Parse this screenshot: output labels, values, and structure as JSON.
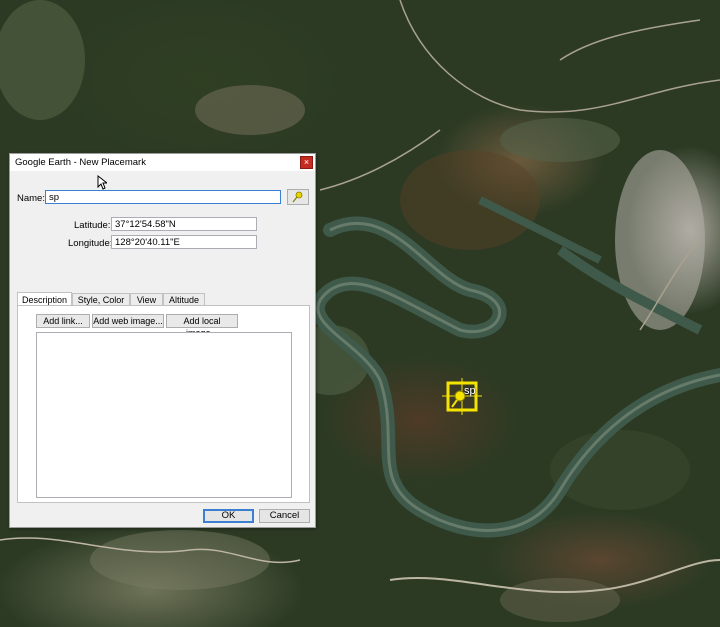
{
  "dialog": {
    "title": "Google Earth - New Placemark",
    "close_glyph": "×",
    "name_label": "Name:",
    "name_value": "sp",
    "latitude_label": "Latitude:",
    "latitude_value": "37°12'54.58\"N",
    "longitude_label": "Longitude:",
    "longitude_value": "128°20'40.11\"E",
    "icon_button": "pushpin-icon",
    "tabs": [
      "Description",
      "Style, Color",
      "View",
      "Altitude"
    ],
    "active_tab": "Description",
    "description_buttons": [
      "Add link...",
      "Add web image...",
      "Add local image..."
    ],
    "ok_label": "OK",
    "cancel_label": "Cancel"
  },
  "map": {
    "placemark_label": "sp",
    "placemark_color": "#f5e400",
    "river_color": "#3f5a4a"
  }
}
